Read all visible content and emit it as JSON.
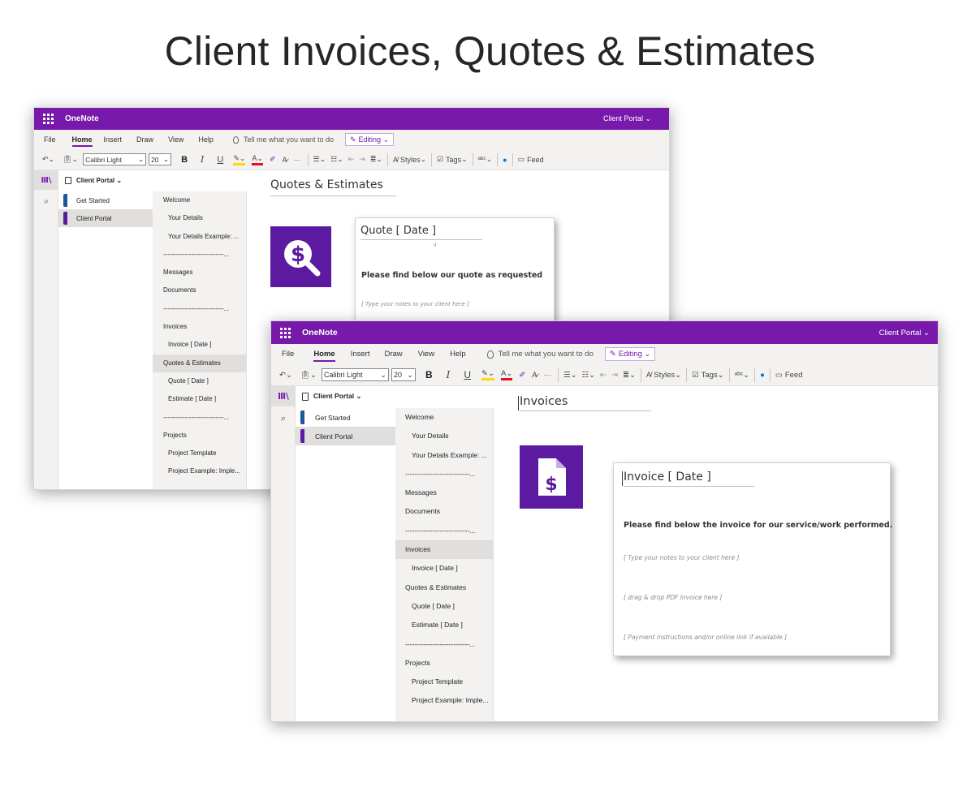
{
  "banner_title": "Client Invoices, Quotes & Estimates",
  "colors": {
    "accent": "#7719aa",
    "logo_bg": "#5b1aa0",
    "selected": "#e1dfdd"
  },
  "window_back": {
    "app_name": "OneNote",
    "portal_label": "Client Portal ⌄",
    "menu": [
      "File",
      "Home",
      "Insert",
      "Draw",
      "View",
      "Help"
    ],
    "tell_me": "Tell me what you want to do",
    "editing": "Editing ⌄",
    "font_name": "Calibri Light",
    "font_size": "20",
    "styles_label": "Styles",
    "tags_label": "Tags",
    "feed_label": "Feed",
    "notebook": "Client Portal ⌄",
    "sections": [
      "Get Started",
      "Client Portal"
    ],
    "pages": [
      "Welcome",
      "Your Details",
      "Your Details Example: ...",
      "----------------------------...",
      "Messages",
      "Documents",
      "----------------------------...",
      "Invoices",
      "Invoice [ Date ]",
      "Quotes & Estimates",
      "Quote [ Date ]",
      "Estimate [ Date ]",
      "----------------------------...",
      "Projects",
      "Project Template",
      "Project Example: Imple..."
    ],
    "page_title": "Quotes & Estimates",
    "card_title": "Quote [ Date ]",
    "card_mark": "ıl",
    "card_bold": "Please find below our quote as requested",
    "card_note": "[ Type your notes to your client here ]"
  },
  "window_front": {
    "app_name": "OneNote",
    "portal_label": "Client Portal ⌄",
    "menu": [
      "File",
      "Home",
      "Insert",
      "Draw",
      "View",
      "Help"
    ],
    "tell_me": "Tell me what you want to do",
    "editing": "Editing ⌄",
    "font_name": "Calibri Light",
    "font_size": "20",
    "styles_label": "Styles",
    "tags_label": "Tags",
    "feed_label": "Feed",
    "notebook": "Client Portal ⌄",
    "sections": [
      "Get Started",
      "Client Portal"
    ],
    "pages": [
      "Welcome",
      "Your Details",
      "Your Details Example: ...",
      "----------------------------...",
      "Messages",
      "Documents",
      "----------------------------...",
      "Invoices",
      "Invoice [ Date ]",
      "Quotes & Estimates",
      "Quote [ Date ]",
      "Estimate [ Date ]",
      "----------------------------...",
      "Projects",
      "Project Template",
      "Project Example: Imple..."
    ],
    "page_title": "Invoices",
    "card_title": "Invoice [ Date ]",
    "card_bold": "Please find below the invoice for our service/work performed.",
    "card_note1": "[ Type your notes to your client here ]",
    "card_note2": "[ drag & drop PDF Invoice here  ]",
    "card_note3": "[ Payment instructions and/or online link if available ]"
  }
}
